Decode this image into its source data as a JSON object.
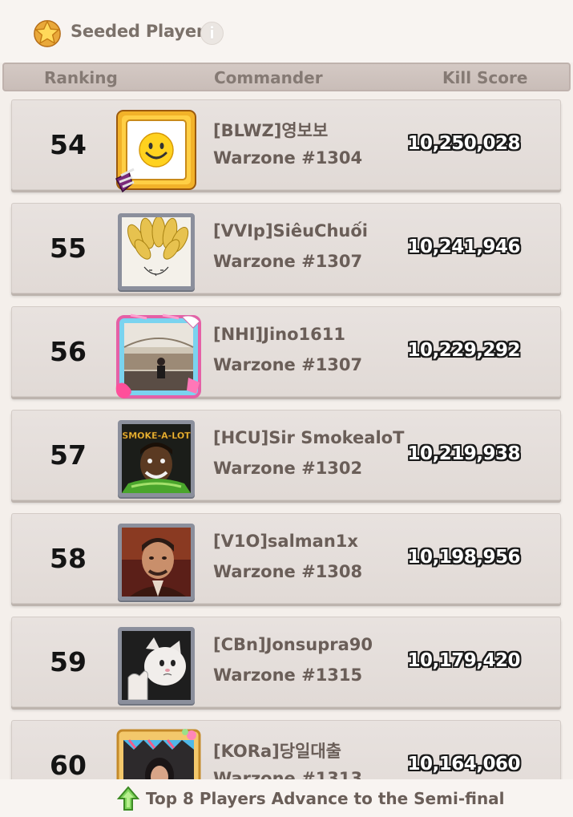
{
  "header": {
    "title": "Seeded Player",
    "info_glyph": "i"
  },
  "columns": {
    "ranking": "Ranking",
    "commander": "Commander",
    "kill_score": "Kill Score"
  },
  "rows": [
    {
      "rank": "54",
      "name": "[BLWZ]영보보",
      "warzone": "Warzone #1304",
      "score": "10,250,028",
      "avatar": "smiley-avatar-icon"
    },
    {
      "rank": "55",
      "name": "[VVIp]SiêuChuối",
      "warzone": "Warzone #1307",
      "score": "10,241,946",
      "avatar": "banana-hair-avatar-icon"
    },
    {
      "rank": "56",
      "name": "[NHI]Jino1611",
      "warzone": "Warzone #1307",
      "score": "10,229,292",
      "avatar": "arena-avatar-icon"
    },
    {
      "rank": "57",
      "name": "[HCU]Sir SmokealoT",
      "warzone": "Warzone #1302",
      "score": "10,219,938",
      "avatar": "smoke-a-lot-avatar-icon"
    },
    {
      "rank": "58",
      "name": "[V1O]salman1x",
      "warzone": "Warzone #1308",
      "score": "10,198,956",
      "avatar": "portrait-avatar-icon"
    },
    {
      "rank": "59",
      "name": "[CBn]Jonsupra90",
      "warzone": "Warzone #1315",
      "score": "10,179,420",
      "avatar": "cat-thumbs-up-avatar-icon"
    },
    {
      "rank": "60",
      "name": "[KORa]당일대출",
      "warzone": "Warzone #1313",
      "score": "10,164,060",
      "avatar": "party-portrait-avatar-icon"
    }
  ],
  "footer": {
    "text": "Top 8 Players Advance to the Semi-final"
  },
  "colors": {
    "background": "#f4efeb",
    "header_bar": "#cfc4bf",
    "row_bg": "#e5dfdb",
    "label_text": "#6a5e58",
    "frame_silver": "#8b8f9c",
    "frame_gold": "#e2a62a"
  }
}
